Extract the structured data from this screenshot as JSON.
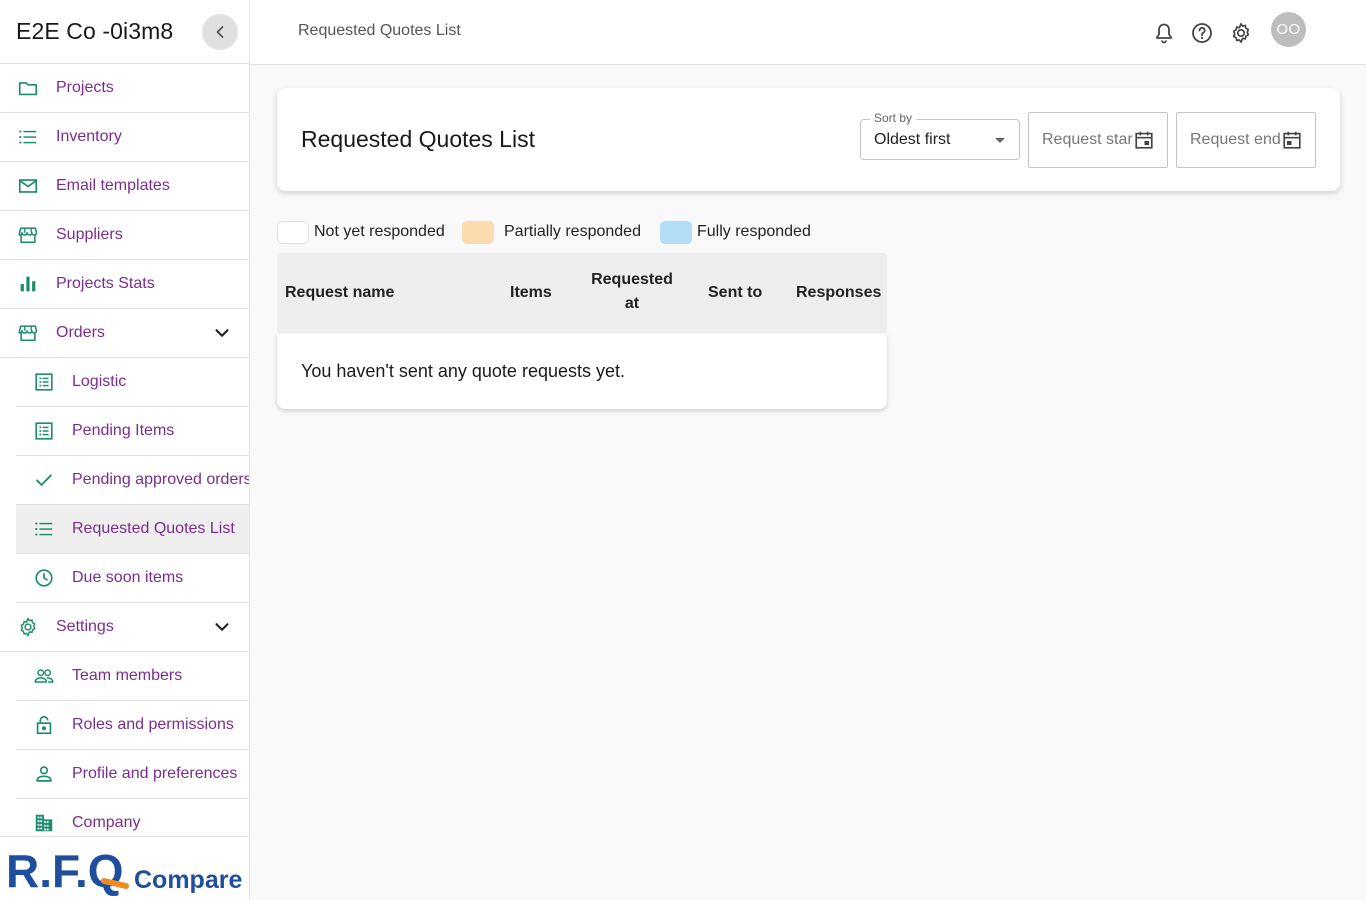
{
  "sidebar": {
    "company_name": "E2E Co -0i3m8",
    "items": [
      {
        "label": "Projects",
        "icon": "folder-icon"
      },
      {
        "label": "Inventory",
        "icon": "list-icon"
      },
      {
        "label": "Email templates",
        "icon": "mail-icon"
      },
      {
        "label": "Suppliers",
        "icon": "store-icon"
      },
      {
        "label": "Projects Stats",
        "icon": "bar-chart-icon"
      },
      {
        "label": "Orders",
        "icon": "store-icon"
      },
      {
        "label": "Logistic",
        "icon": "list-alt-icon"
      },
      {
        "label": "Pending Items",
        "icon": "list-alt-icon"
      },
      {
        "label": "Pending approved orders",
        "icon": "check-icon"
      },
      {
        "label": "Requested Quotes List",
        "icon": "list-icon"
      },
      {
        "label": "Due soon items",
        "icon": "clock-icon"
      },
      {
        "label": "Settings",
        "icon": "gear-icon"
      },
      {
        "label": "Team members",
        "icon": "people-icon"
      },
      {
        "label": "Roles and permissions",
        "icon": "lock-icon"
      },
      {
        "label": "Profile and preferences",
        "icon": "person-icon"
      },
      {
        "label": "Company",
        "icon": "building-icon"
      }
    ],
    "logo": {
      "main": "R.F.Q",
      "sub": "Compare"
    }
  },
  "topbar": {
    "breadcrumb": "Requested Quotes List",
    "avatar_initials": "OO"
  },
  "header": {
    "title": "Requested Quotes List",
    "sort_label": "Sort by",
    "sort_value": "Oldest first",
    "request_start_placeholder": "Request start",
    "request_end_placeholder": "Request end"
  },
  "legend": [
    {
      "label": "Not yet responded",
      "color": "#ffffff"
    },
    {
      "label": "Partially responded",
      "color": "#fbdcb1"
    },
    {
      "label": "Fully responded",
      "color": "#b3dff6"
    }
  ],
  "table": {
    "columns": [
      "Request name",
      "Items",
      "Requested at",
      "Sent to",
      "Responses"
    ],
    "empty_message": "You haven't sent any quote requests yet."
  },
  "colors": {
    "accent_purple": "#7b2d8e",
    "icon_teal": "#1e8a6e",
    "logo_blue": "#1f4e9c",
    "logo_orange": "#f08a24"
  }
}
